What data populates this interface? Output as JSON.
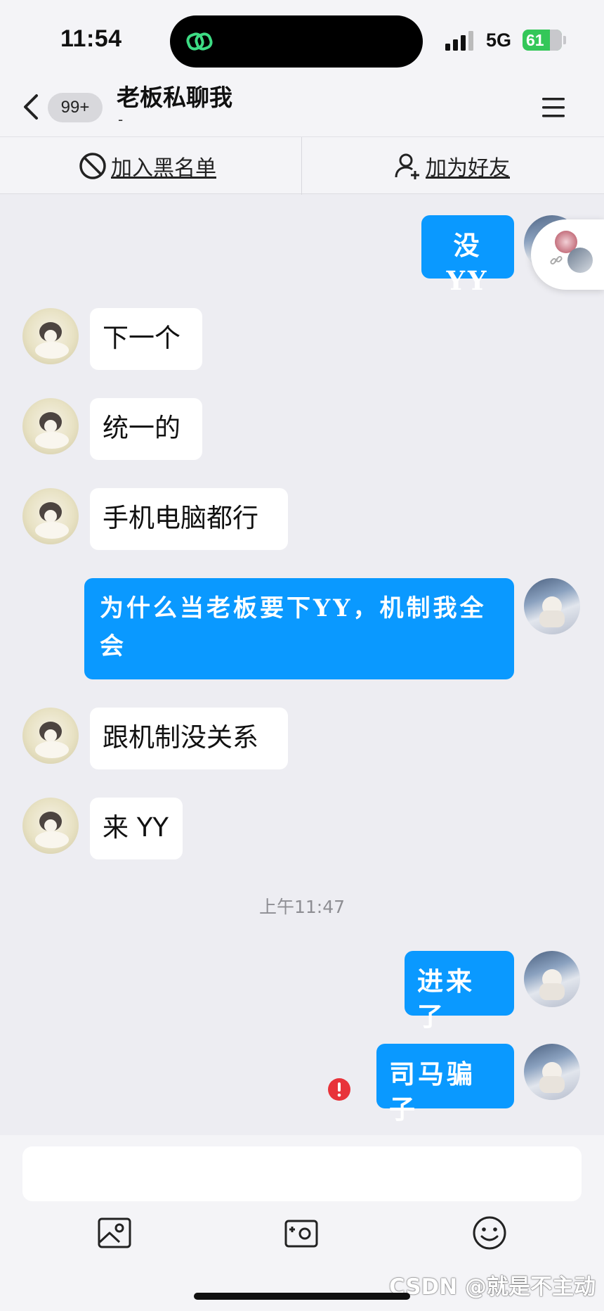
{
  "status_bar": {
    "time": "11:54",
    "network": "5G",
    "battery": "61"
  },
  "nav": {
    "unread_count": "99+",
    "title": "老板私聊我",
    "subtitle": "-"
  },
  "actions": {
    "blacklist_label": "加入黑名单",
    "add_friend_label": "加为好友"
  },
  "messages": [
    {
      "side": "right",
      "text": "没YY"
    },
    {
      "side": "left",
      "text": "下一个"
    },
    {
      "side": "left",
      "text": "统一的"
    },
    {
      "side": "left",
      "text": "手机电脑都行"
    },
    {
      "side": "right",
      "text": "为什么当老板要下YY，机制我全会"
    },
    {
      "side": "left",
      "text": "跟机制没关系"
    },
    {
      "side": "left",
      "text": "来 YY"
    },
    {
      "side": "right",
      "text": "进来了"
    },
    {
      "side": "right",
      "text": "司马骗子",
      "status": "failed"
    }
  ],
  "timestamp": "上午11:47",
  "input": {
    "placeholder": ""
  },
  "toolbar": {
    "icons": [
      "image-icon",
      "camera-icon",
      "emoji-icon"
    ]
  },
  "watermark": "CSDN @就是不主动",
  "colors": {
    "outgoing_bubble": "#0a99ff",
    "incoming_bubble": "#ffffff",
    "background": "#ededf2",
    "error": "#e8333a"
  }
}
